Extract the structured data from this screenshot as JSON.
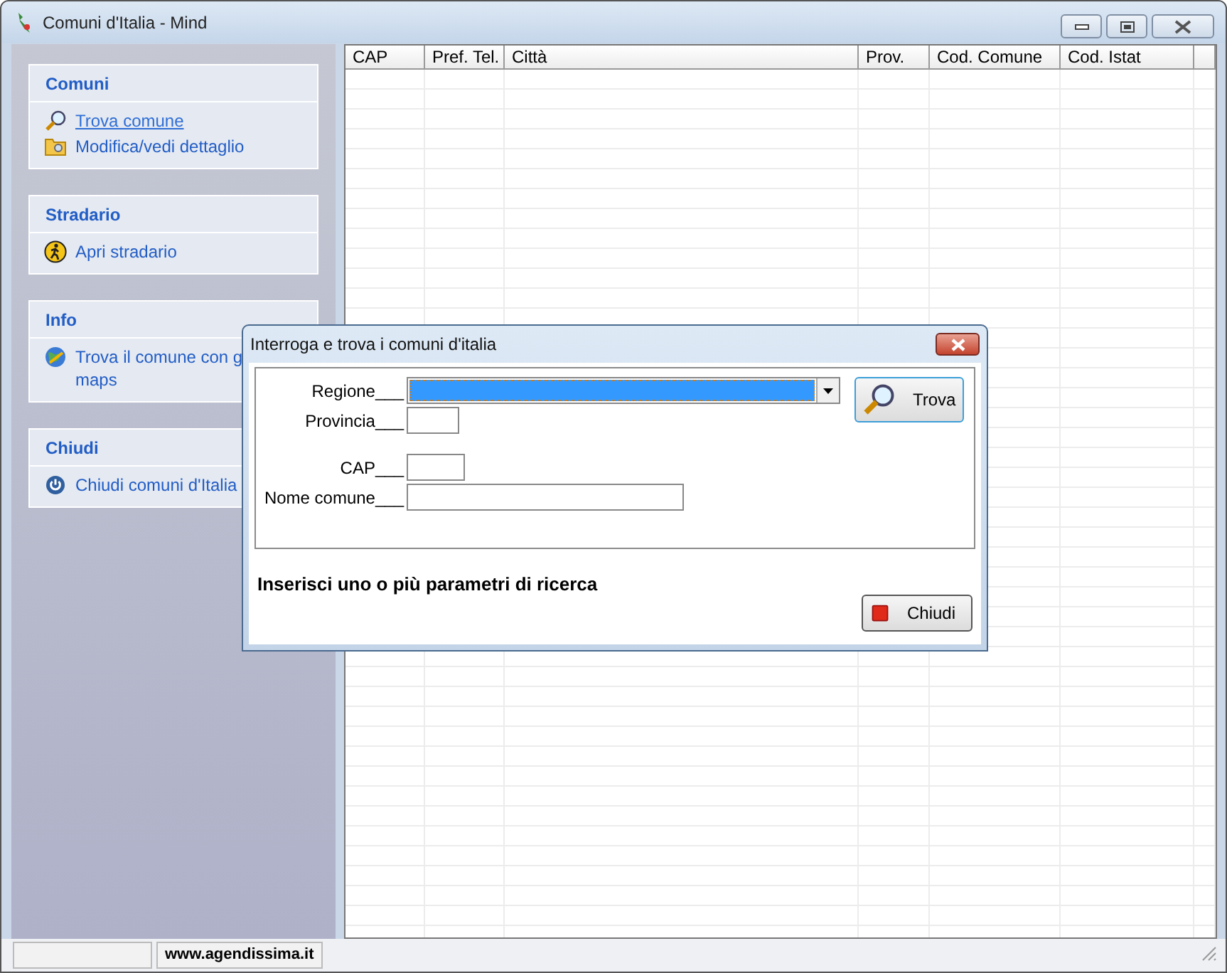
{
  "window": {
    "title": "Comuni d'Italia - Mind"
  },
  "sidebar": {
    "groups": [
      {
        "title": "Comuni",
        "items": [
          {
            "label": "Trova comune",
            "link": true
          },
          {
            "label": "Modifica/vedi dettaglio",
            "link": false
          }
        ]
      },
      {
        "title": "Stradario",
        "items": [
          {
            "label": "Apri stradario",
            "link": false
          }
        ]
      },
      {
        "title": "Info",
        "items": [
          {
            "label": "Trova il comune con g\nmaps",
            "link": false
          }
        ]
      },
      {
        "title": "Chiudi",
        "items": [
          {
            "label": "Chiudi comuni d'Italia",
            "link": false
          }
        ]
      }
    ]
  },
  "table": {
    "columns": [
      "CAP",
      "Pref. Tel.",
      "Città",
      "Prov.",
      "Cod. Comune",
      "Cod. Istat"
    ]
  },
  "status_bar": {
    "text": "www.agendissima.it"
  },
  "dialog": {
    "title": "Interroga e trova i comuni d'italia",
    "fields": [
      {
        "label": "Regione___",
        "kind": "dropdown",
        "selected": true
      },
      {
        "label": "Provincia___",
        "kind": "small"
      },
      {
        "label": "CAP___",
        "kind": "small"
      },
      {
        "label": "Nome comune___",
        "kind": "wide"
      }
    ],
    "message": "Inserisci uno o più parametri di ricerca",
    "buttons": [
      {
        "label": "Trova"
      },
      {
        "label": "Chiudi"
      }
    ]
  }
}
